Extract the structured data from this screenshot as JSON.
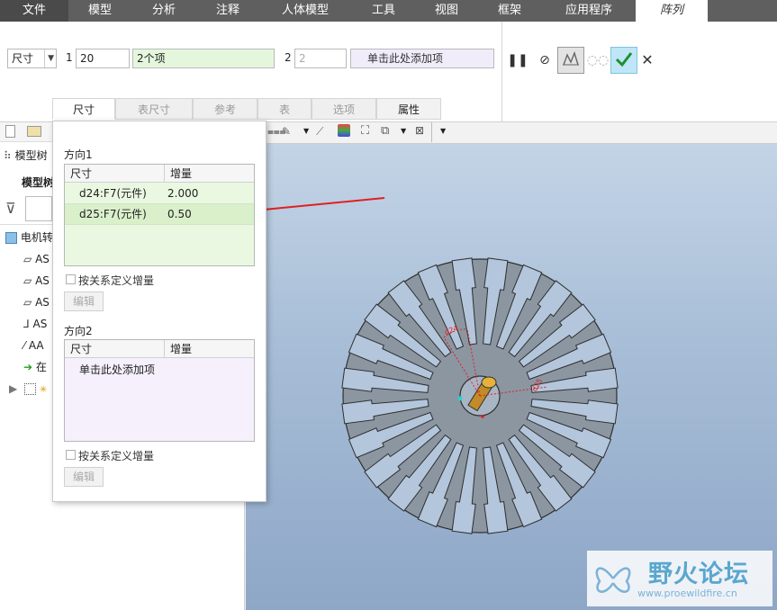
{
  "menubar": {
    "tabs": [
      {
        "label": "文件",
        "kind": "file"
      },
      {
        "label": "模型",
        "kind": "normal"
      },
      {
        "label": "分析",
        "kind": "normal"
      },
      {
        "label": "注释",
        "kind": "normal"
      },
      {
        "label": "人体模型",
        "kind": "normal"
      },
      {
        "label": "工具",
        "kind": "normal"
      },
      {
        "label": "视图",
        "kind": "normal"
      },
      {
        "label": "框架",
        "kind": "normal"
      },
      {
        "label": "应用程序",
        "kind": "normal"
      },
      {
        "label": "阵列",
        "kind": "active"
      }
    ]
  },
  "ribbon": {
    "type_select": "尺寸",
    "dir1_index": "1",
    "dir1_count": "20",
    "dir1_items": "2个项",
    "dir2_index": "2",
    "dir2_count": "2",
    "dir2_items": "单击此处添加项"
  },
  "subtabs": [
    {
      "label": "尺寸",
      "state": "on"
    },
    {
      "label": "表尺寸",
      "state": "off"
    },
    {
      "label": "参考",
      "state": "off"
    },
    {
      "label": "表",
      "state": "off"
    },
    {
      "label": "选项",
      "state": "off"
    },
    {
      "label": "属性",
      "state": "dark"
    }
  ],
  "tree": {
    "header": "模型树",
    "subheader": "模型树",
    "root": "电机转",
    "items": [
      {
        "icon": "plane-icon",
        "label": "AS"
      },
      {
        "icon": "plane-icon",
        "label": "AS"
      },
      {
        "icon": "plane-icon",
        "label": "AS"
      },
      {
        "icon": "csys-icon",
        "label": "AS"
      },
      {
        "icon": "axis-icon",
        "label": "AA"
      },
      {
        "icon": "insert-arrow-icon",
        "label": "在"
      }
    ]
  },
  "popup": {
    "dir1_title": "方向1",
    "dir2_title": "方向2",
    "col_dim": "尺寸",
    "col_inc": "增量",
    "dir1_rows": [
      {
        "dim": "d24:F7(元件)",
        "inc": "2.000"
      },
      {
        "dim": "d25:F7(元件)",
        "inc": "0.50"
      }
    ],
    "dir2_placeholder": "单击此处添加项",
    "relation_label": "按关系定义增量",
    "edit_label": "编辑"
  },
  "watermark": {
    "brand": "野火论坛",
    "url": "www.proewildfire.cn"
  },
  "colors": {
    "menubar": "#5f5f5f",
    "table_green": "#eaf8e2",
    "table_purple": "#f5f0fc",
    "accent_green": "#2c9a3a",
    "arrow_red": "#e02020"
  }
}
